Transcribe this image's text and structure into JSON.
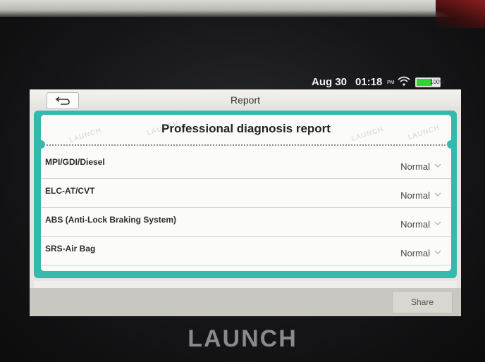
{
  "status_bar": {
    "date": "Aug 30",
    "time": "01:18",
    "ampm": "PM",
    "battery": "100%",
    "icons": [
      "wifi-icon",
      "battery-icon"
    ]
  },
  "header": {
    "title": "Report",
    "back_icon": "back-arrow-icon"
  },
  "report": {
    "heading": "Professional diagnosis report",
    "watermark": "LAUNCH",
    "rows": [
      {
        "label": "MPI/GDI/Diesel",
        "status": "Normal"
      },
      {
        "label": "ELC-AT/CVT",
        "status": "Normal"
      },
      {
        "label": "ABS (Anti-Lock Braking System)",
        "status": "Normal"
      },
      {
        "label": "SRS-Air Bag",
        "status": "Normal"
      }
    ]
  },
  "footer": {
    "share_label": "Share"
  },
  "device": {
    "brand": "LAUNCH"
  },
  "colors": {
    "accent_teal": "#35b8ae",
    "battery_green": "#2fd43a"
  }
}
